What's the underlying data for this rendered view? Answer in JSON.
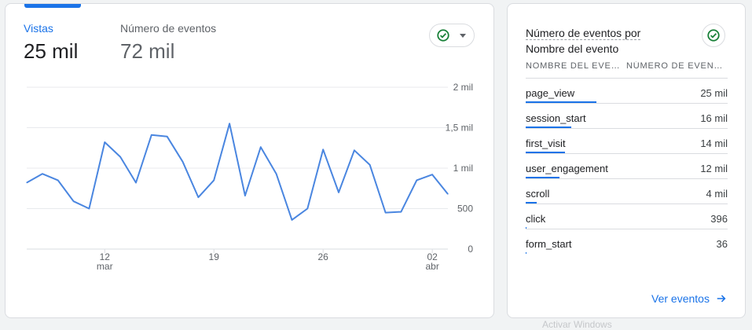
{
  "metrics": {
    "vistas": {
      "label": "Vistas",
      "value": "25 mil"
    },
    "eventos": {
      "label": "Número de eventos",
      "value": "72 mil"
    }
  },
  "chart_data": {
    "type": "line",
    "y_ticks": [
      "2 mil",
      "1,5 mil",
      "1 mil",
      "500",
      "0"
    ],
    "ylim": [
      0,
      2000
    ],
    "x_ticks": [
      {
        "label": "12",
        "sub": "mar",
        "index": 5
      },
      {
        "label": "19",
        "sub": "",
        "index": 12
      },
      {
        "label": "26",
        "sub": "",
        "index": 19
      },
      {
        "label": "02",
        "sub": "abr",
        "index": 26
      }
    ],
    "series": [
      {
        "color": "#4a86e0",
        "values": [
          820,
          930,
          850,
          590,
          500,
          1320,
          1140,
          820,
          1410,
          1390,
          1080,
          640,
          850,
          1550,
          660,
          1260,
          930,
          360,
          500,
          1230,
          700,
          1220,
          1040,
          450,
          460,
          850,
          920,
          680
        ]
      }
    ]
  },
  "side": {
    "title_line1": "Número de eventos por",
    "title_line2": "Nombre del evento",
    "col1": "NOMBRE DEL EVE…",
    "col2": "NÚMERO DE EVEN…",
    "rows": [
      {
        "name": "page_view",
        "value": "25 mil",
        "share": 1.0
      },
      {
        "name": "session_start",
        "value": "16 mil",
        "share": 0.64
      },
      {
        "name": "first_visit",
        "value": "14 mil",
        "share": 0.56
      },
      {
        "name": "user_engagement",
        "value": "12 mil",
        "share": 0.48
      },
      {
        "name": "scroll",
        "value": "4 mil",
        "share": 0.16
      },
      {
        "name": "click",
        "value": "396",
        "share": 0.016
      },
      {
        "name": "form_start",
        "value": "36",
        "share": 0.0015
      }
    ],
    "link": "Ver eventos"
  },
  "colors": {
    "accent": "#1a73e8",
    "check": "#188038"
  },
  "icons": {
    "compare": "check-circle-icon",
    "dropdown": "caret-down-icon",
    "link_arrow": "arrow-right-icon"
  },
  "ghost_text": "Activar Windows"
}
